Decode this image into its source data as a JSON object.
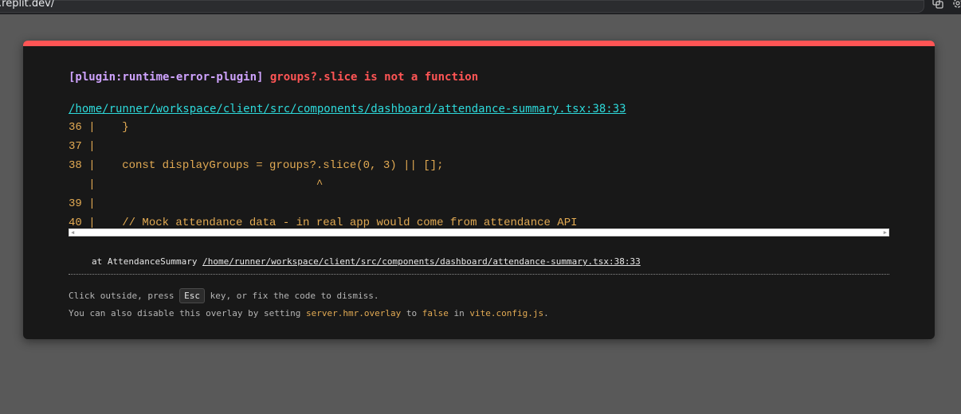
{
  "browser": {
    "url": ".replit.dev/"
  },
  "error": {
    "plugin": "[plugin:runtime-error-plugin]",
    "message": "groups?.slice is not a function",
    "file": "/home/runner/workspace/client/src/components/dashboard/attendance-summary.tsx:38:33",
    "frame": "36 |    }\n37 |\n38 |    const displayGroups = groups?.slice(0, 3) || [];\n   |                                 ^\n39 |\n40 |    // Mock attendance data - in real app would come from attendance API",
    "stack_prefix": "at AttendanceSummary",
    "stack_file": "/home/runner/workspace/client/src/components/dashboard/attendance-summary.tsx:38:33"
  },
  "tip": {
    "line1_before": "Click outside, press",
    "key": "Esc",
    "line1_after": "key, or fix the code to dismiss.",
    "line2_part1": "You can also disable this overlay by setting",
    "line2_setting": "server.hmr.overlay",
    "line2_part2": "to",
    "line2_value": "false",
    "line2_part3": "in",
    "line2_file": "vite.config.js",
    "line2_end": "."
  },
  "colors": {
    "accent": "#ff5555",
    "plugin": "#cfa3ff",
    "link": "#2dd9da",
    "frame": "#e2aa53"
  }
}
